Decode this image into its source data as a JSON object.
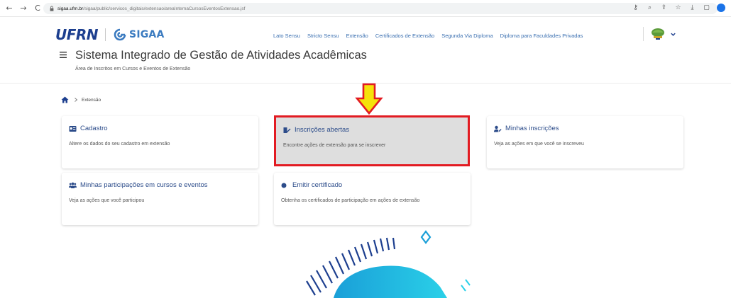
{
  "browser": {
    "url_host": "sigaa.ufrn.br",
    "url_path": "/sigaa/public/servicos_digitais/extensao/areaInternaCursosEventosExtensao.jsf"
  },
  "header": {
    "logo_text": "UFRN",
    "sigaa_text": "SIGAA",
    "nav": [
      "Lato Sensu",
      "Stricto Sensu",
      "Extensão",
      "Certificados de Extensão",
      "Segunda Via Diploma",
      "Diploma para Faculdades Privadas"
    ],
    "title": "Sistema Integrado de Gestão de Atividades Acadêmicas",
    "subtitle": "Área de Inscritos em Cursos e Eventos de Extensão"
  },
  "breadcrumb": {
    "current": "Extensão"
  },
  "cards": {
    "cadastro": {
      "title": "Cadastro",
      "desc": "Altere os dados do seu cadastro em extensão",
      "icon": "id-card-icon"
    },
    "inscricoes_abertas": {
      "title": "Inscrições abertas",
      "desc": "Encontre ações de extensão para se inscrever",
      "icon": "pen-icon"
    },
    "minhas_inscricoes": {
      "title": "Minhas inscrições",
      "desc": "Veja as ações em que você se inscreveu",
      "icon": "user-pen-icon"
    },
    "minhas_participacoes": {
      "title": "Minhas participações em cursos e eventos",
      "desc": "Veja as ações que você participou",
      "icon": "users-icon"
    },
    "emitir_certificado": {
      "title": "Emitir certificado",
      "desc": "Obtenha os certificados de participação em ações de extensão",
      "icon": "circle-icon"
    }
  },
  "colors": {
    "link_blue": "#3a6fb0",
    "card_title": "#2c4c8a",
    "highlight_border": "#e21b22",
    "arrow_fill": "#f5e20a",
    "arrow_stroke": "#e21b22"
  }
}
